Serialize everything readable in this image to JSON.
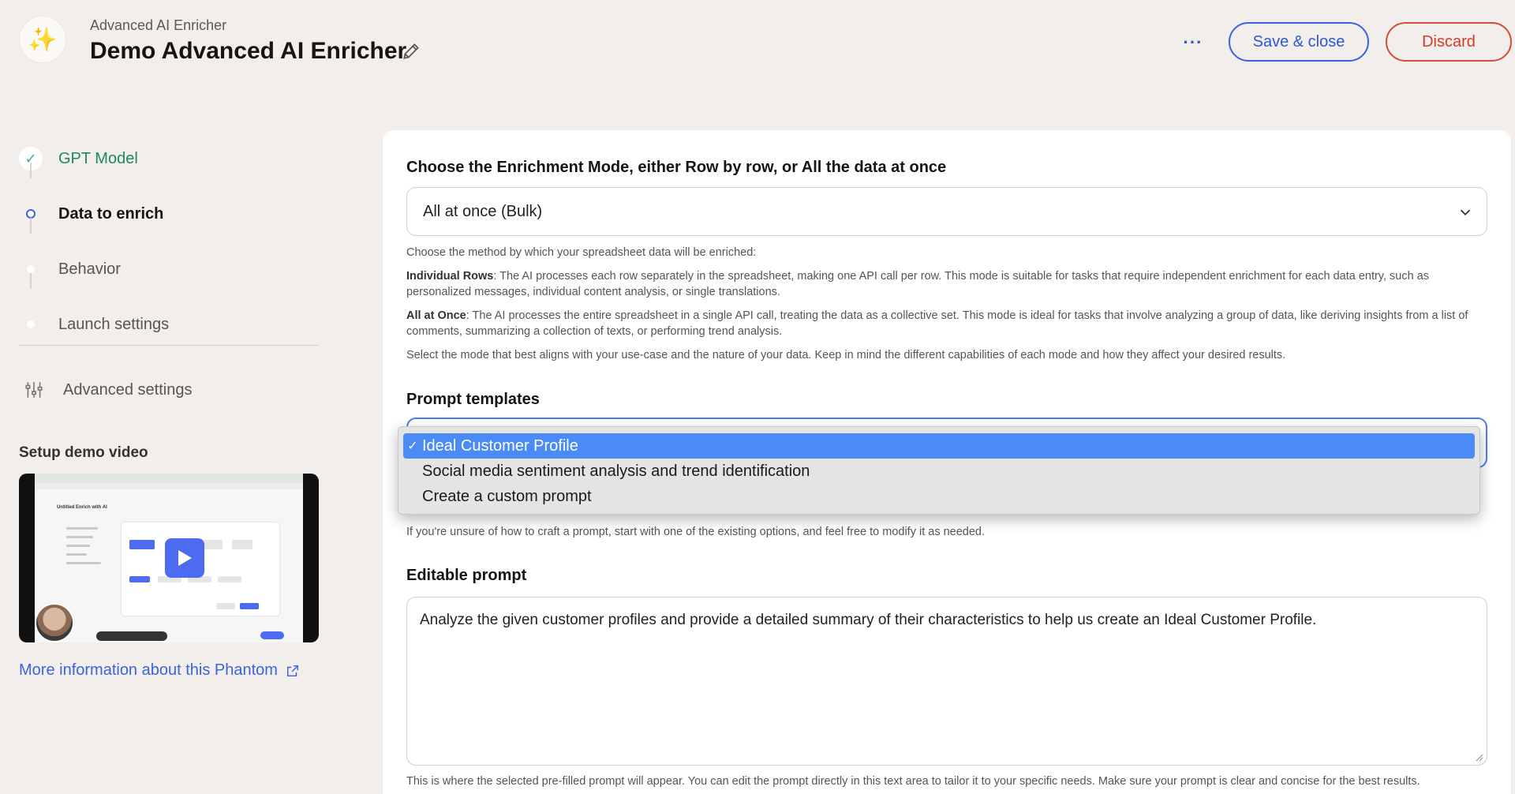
{
  "header": {
    "subtitle": "Advanced AI Enricher",
    "title": "Demo Advanced AI Enricher",
    "more_label": "···",
    "save_label": "Save & close",
    "discard_label": "Discard",
    "logo_icon": "sparkles-icon"
  },
  "sidebar": {
    "steps": [
      {
        "label": "GPT Model",
        "state": "done"
      },
      {
        "label": "Data to enrich",
        "state": "active"
      },
      {
        "label": "Behavior",
        "state": "idle"
      },
      {
        "label": "Launch settings",
        "state": "idle"
      }
    ],
    "advanced_label": "Advanced settings",
    "demo_title": "Setup demo video",
    "video_title": "Untitled Enrich with AI",
    "more_info_label": "More information about this Phantom"
  },
  "main": {
    "mode_title": "Choose the Enrichment Mode, either Row by row, or All the data at once",
    "mode_value": "All at once (Bulk)",
    "mode_help_intro": "Choose the method by which your spreadsheet data will be enriched:",
    "mode_help_rows_label": "Individual Rows",
    "mode_help_rows_text": ": The AI processes each row separately in the spreadsheet, making one API call per row. This mode is suitable for tasks that require independent enrichment for each data entry, such as personalized messages, individual content analysis, or single translations.",
    "mode_help_once_label": "All at Once",
    "mode_help_once_text": ": The AI processes the entire spreadsheet in a single API call, treating the data as a collective set. This mode is ideal for tasks that involve analyzing a group of data, like deriving insights from a list of comments, summarizing a collection of texts, or performing trend analysis.",
    "mode_help_outro": "Select the mode that best aligns with your use-case and the nature of your data. Keep in mind the different capabilities of each mode and how they affect your desired results.",
    "templates_title": "Prompt templates",
    "templates_options": [
      {
        "label": "Ideal Customer Profile",
        "selected": true
      },
      {
        "label": "Social media sentiment analysis and trend identification",
        "selected": false
      },
      {
        "label": "Create a custom prompt",
        "selected": false
      }
    ],
    "templates_help": "If you're unsure of how to craft a prompt, start with one of the existing options, and feel free to modify it as needed.",
    "prompt_title": "Editable prompt",
    "prompt_value": "Analyze the given customer profiles and provide a detailed summary of their characteristics to help us create an Ideal Customer Profile.",
    "prompt_help": "This is where the selected pre-filled prompt will appear. You can edit the prompt directly in this text area to tailor it to your specific needs. Make sure your prompt is clear and concise for the best results."
  },
  "colors": {
    "accent": "#3d62e0",
    "danger": "#d23a29",
    "success": "#1e8a5a",
    "selected_option": "#4a8bf5"
  }
}
